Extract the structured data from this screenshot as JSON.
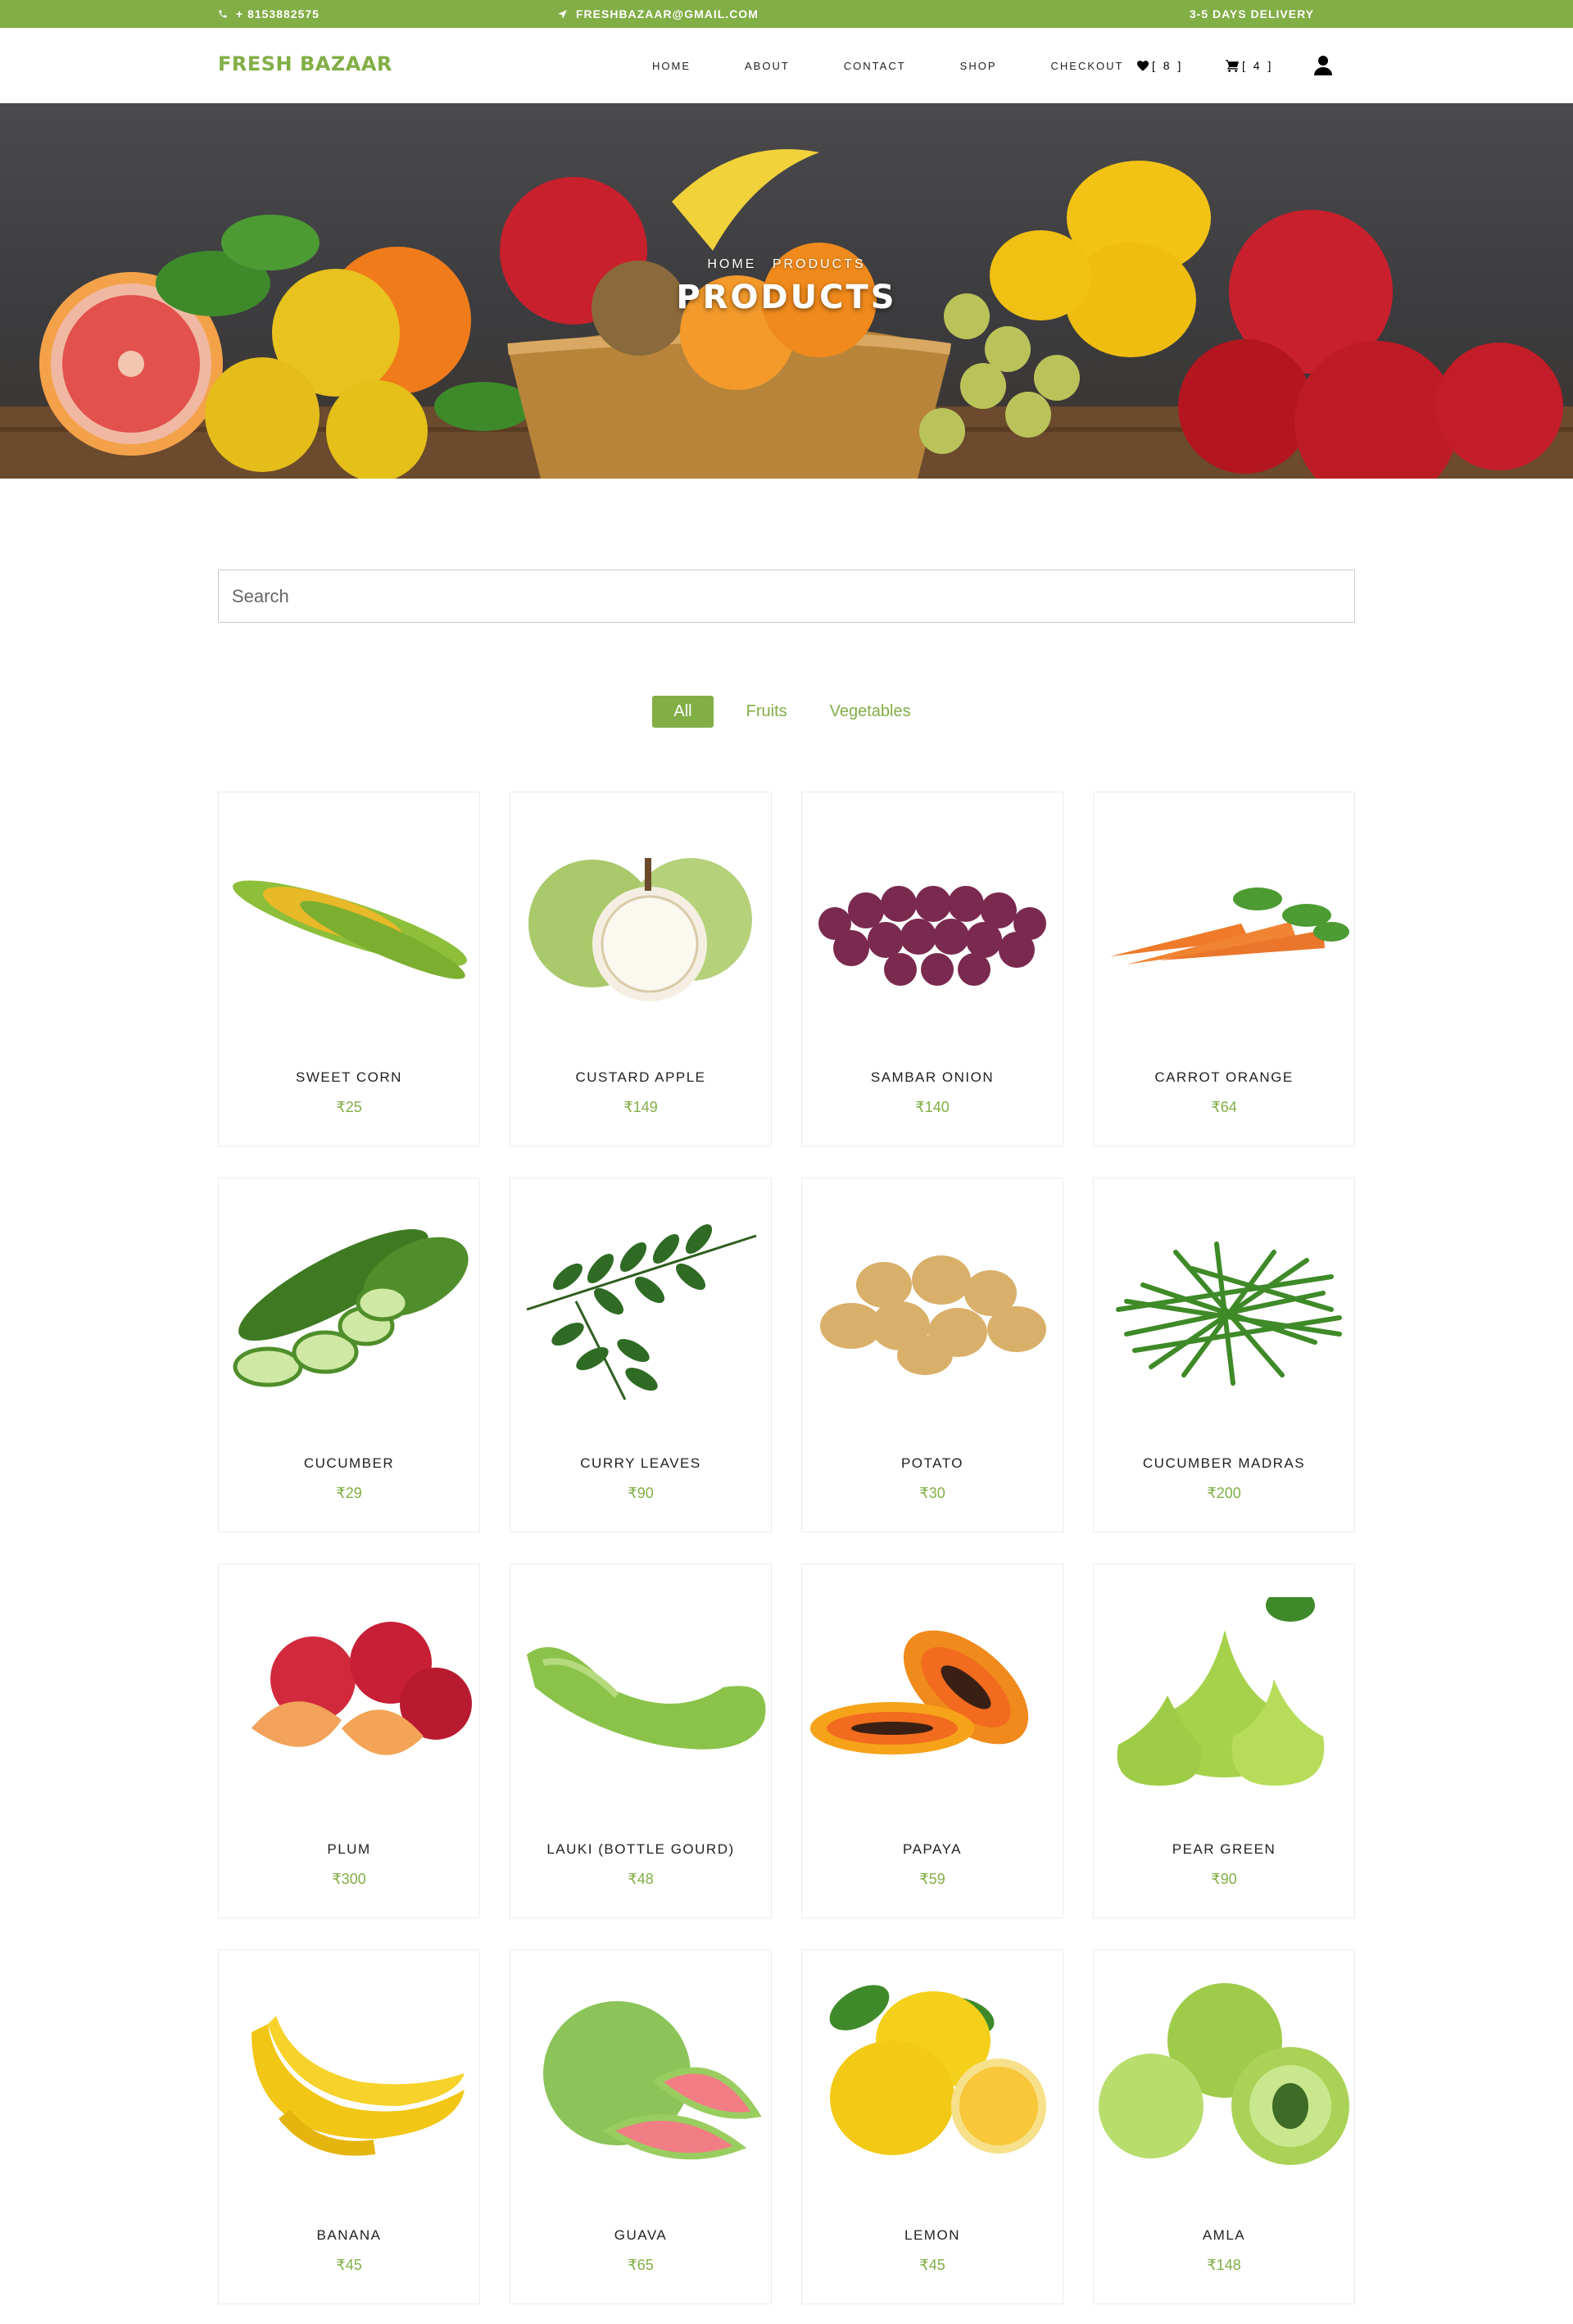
{
  "topbar": {
    "phone": "+ 8153882575",
    "email": "FRESHBAZAAR@GMAIL.COM",
    "delivery": "3-5 DAYS DELIVERY"
  },
  "brand": "FRESH BAZAAR",
  "nav": {
    "links": [
      "HOME",
      "ABOUT",
      "CONTACT",
      "SHOP",
      "CHECKOUT"
    ],
    "wishlist_count": "[ 8 ]",
    "cart_count": "[ 4 ]"
  },
  "hero": {
    "breadcrumb_home": "HOME",
    "breadcrumb_current": "PRODUCTS",
    "title": "PRODUCTS"
  },
  "search": {
    "placeholder": "Search"
  },
  "filters": [
    "All",
    "Fruits",
    "Vegetables"
  ],
  "active_filter": "All",
  "currency": "₹",
  "products": [
    {
      "name": "SWEET CORN",
      "price": "₹25"
    },
    {
      "name": "CUSTARD APPLE",
      "price": "₹149"
    },
    {
      "name": "SAMBAR ONION",
      "price": "₹140"
    },
    {
      "name": "CARROT ORANGE",
      "price": "₹64"
    },
    {
      "name": "CUCUMBER",
      "price": "₹29"
    },
    {
      "name": "CURRY LEAVES",
      "price": "₹90"
    },
    {
      "name": "POTATO",
      "price": "₹30"
    },
    {
      "name": "CUCUMBER MADRAS",
      "price": "₹200"
    },
    {
      "name": "PLUM",
      "price": "₹300"
    },
    {
      "name": "LAUKI (BOTTLE GOURD)",
      "price": "₹48"
    },
    {
      "name": "PAPAYA",
      "price": "₹59"
    },
    {
      "name": "PEAR GREEN",
      "price": "₹90"
    },
    {
      "name": "BANANA",
      "price": "₹45"
    },
    {
      "name": "GUAVA",
      "price": "₹65"
    },
    {
      "name": "LEMON",
      "price": "₹45"
    },
    {
      "name": "AMLA",
      "price": "₹148"
    }
  ],
  "colors": {
    "accent": "#82ae46",
    "text": "#222222",
    "border": "#ececec"
  }
}
